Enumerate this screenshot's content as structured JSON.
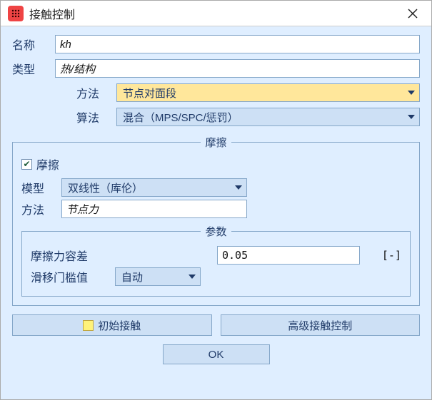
{
  "titlebar": {
    "title": "接触控制"
  },
  "fields": {
    "name_label": "名称",
    "name_value": "kh",
    "type_label": "类型",
    "type_value": "热/结构",
    "method_label": "方法",
    "method_value": "节点对面段",
    "algo_label": "算法",
    "algo_value": "混合（MPS/SPC/惩罚）"
  },
  "friction": {
    "legend": "摩擦",
    "checkbox_label": "摩擦",
    "model_label": "模型",
    "model_value": "双线性（库伦）",
    "method_label": "方法",
    "method_value": "节点力",
    "params": {
      "legend": "参数",
      "tol_label": "摩擦力容差",
      "tol_value": "0.05",
      "tol_unit": "[-]",
      "slip_label": "滑移门槛值",
      "slip_value": "自动"
    }
  },
  "buttons": {
    "initial_contact": "初始接触",
    "advanced": "高级接触控制",
    "ok": "OK"
  }
}
